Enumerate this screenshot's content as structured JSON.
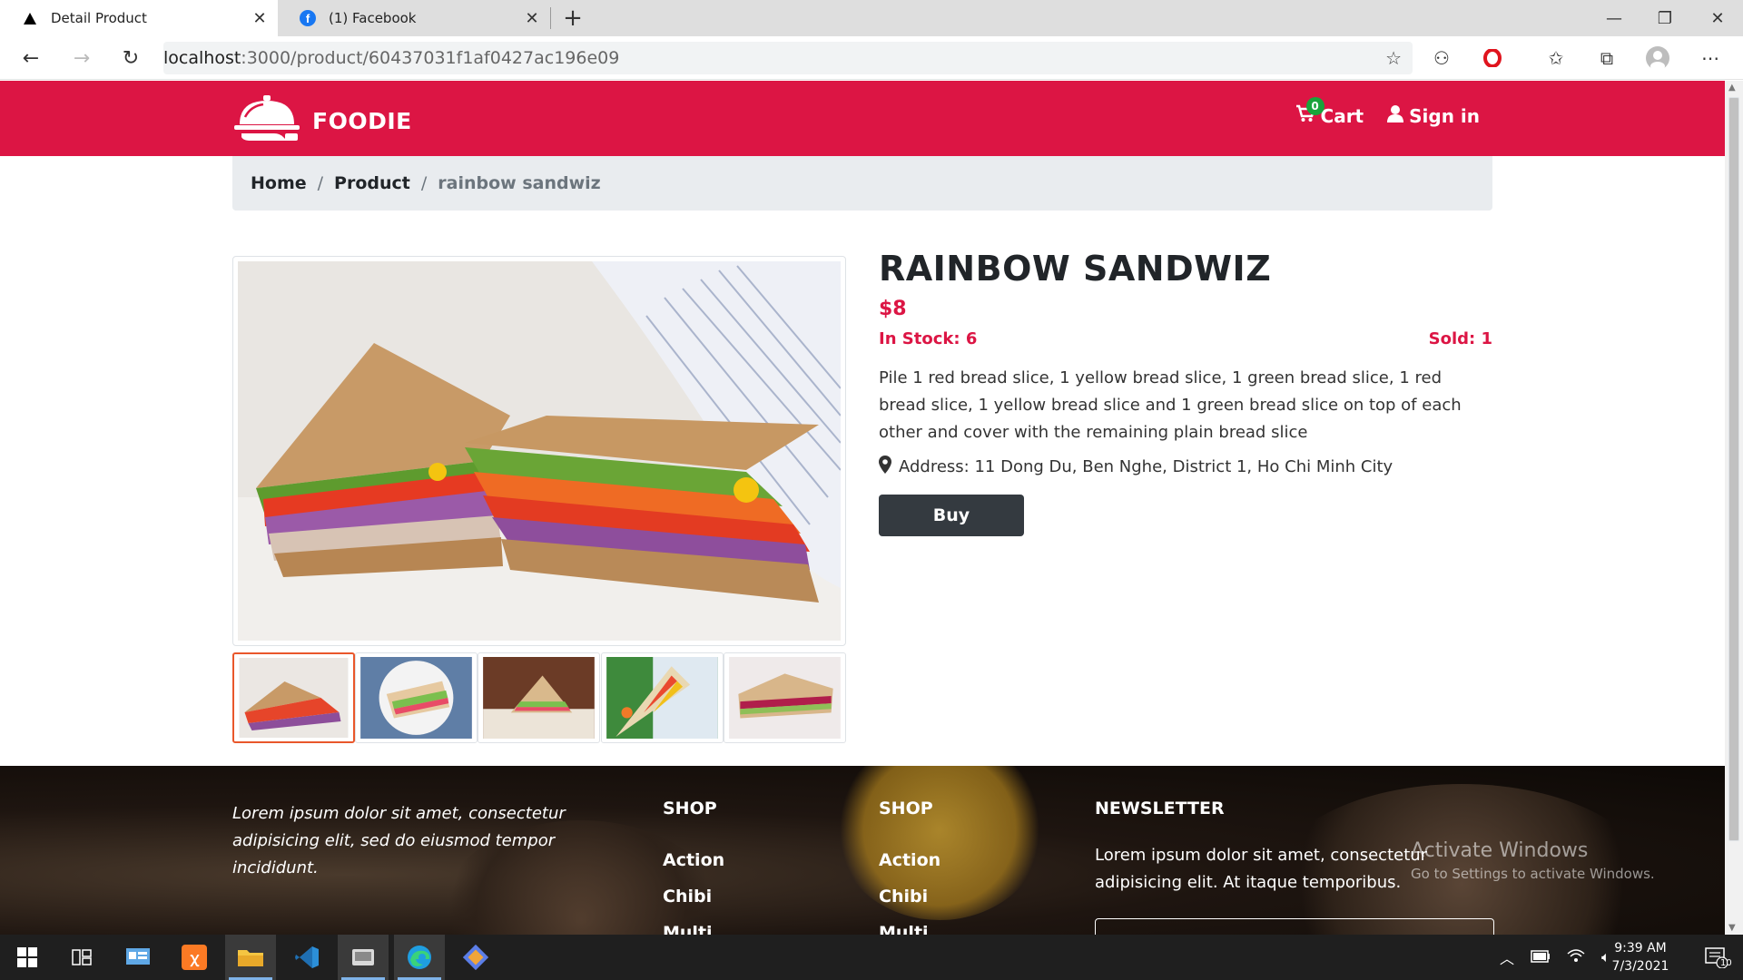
{
  "browser": {
    "tabs": [
      {
        "title": "Detail Product",
        "icon": "vercel-triangle-icon"
      },
      {
        "title": "(1) Facebook",
        "icon": "facebook-icon"
      }
    ],
    "url_host": "localhost",
    "url_path": ":3000/product/60437031f1af0427ac196e09"
  },
  "navbar": {
    "brand": "FOODIE",
    "cart_label": "Cart",
    "cart_count": "0",
    "signin_label": "Sign in",
    "color": "#dc1544"
  },
  "breadcrumb": {
    "items": [
      "Home",
      "Product"
    ],
    "separator": "/",
    "current": "rainbow sandwiz"
  },
  "product": {
    "title": "RAINBOW SANDWIZ",
    "price": "$8",
    "stock": "In Stock: 6",
    "sold": "Sold: 1",
    "description": "Pile 1 red bread slice, 1 yellow bread slice, 1 green bread slice, 1 red bread slice, 1 yellow bread slice and 1 green bread slice on top of each other and cover with the remaining plain bread slice",
    "address": "Address: 11 Dong Du, Ben Nghe, District 1, Ho Chi Minh City",
    "buy_label": "Buy"
  },
  "footer": {
    "about": "Lorem ipsum dolor sit amet, consectetur adipisicing elit, sed do eiusmod tempor incididunt.",
    "col1": {
      "heading": "SHOP",
      "items": [
        "Action",
        "Chibi",
        "Multi"
      ]
    },
    "col2": {
      "heading": "SHOP",
      "items": [
        "Action",
        "Chibi",
        "Multi"
      ]
    },
    "newsletter": {
      "heading": "NEWSLETTER",
      "text": "Lorem ipsum dolor sit amet, consectetur adipisicing elit. At itaque temporibus."
    }
  },
  "watermark": {
    "line1": "Activate Windows",
    "line2": "Go to Settings to activate Windows."
  },
  "taskbar": {
    "time": "9:39 AM",
    "date": "7/3/2021",
    "notifications": "10"
  }
}
